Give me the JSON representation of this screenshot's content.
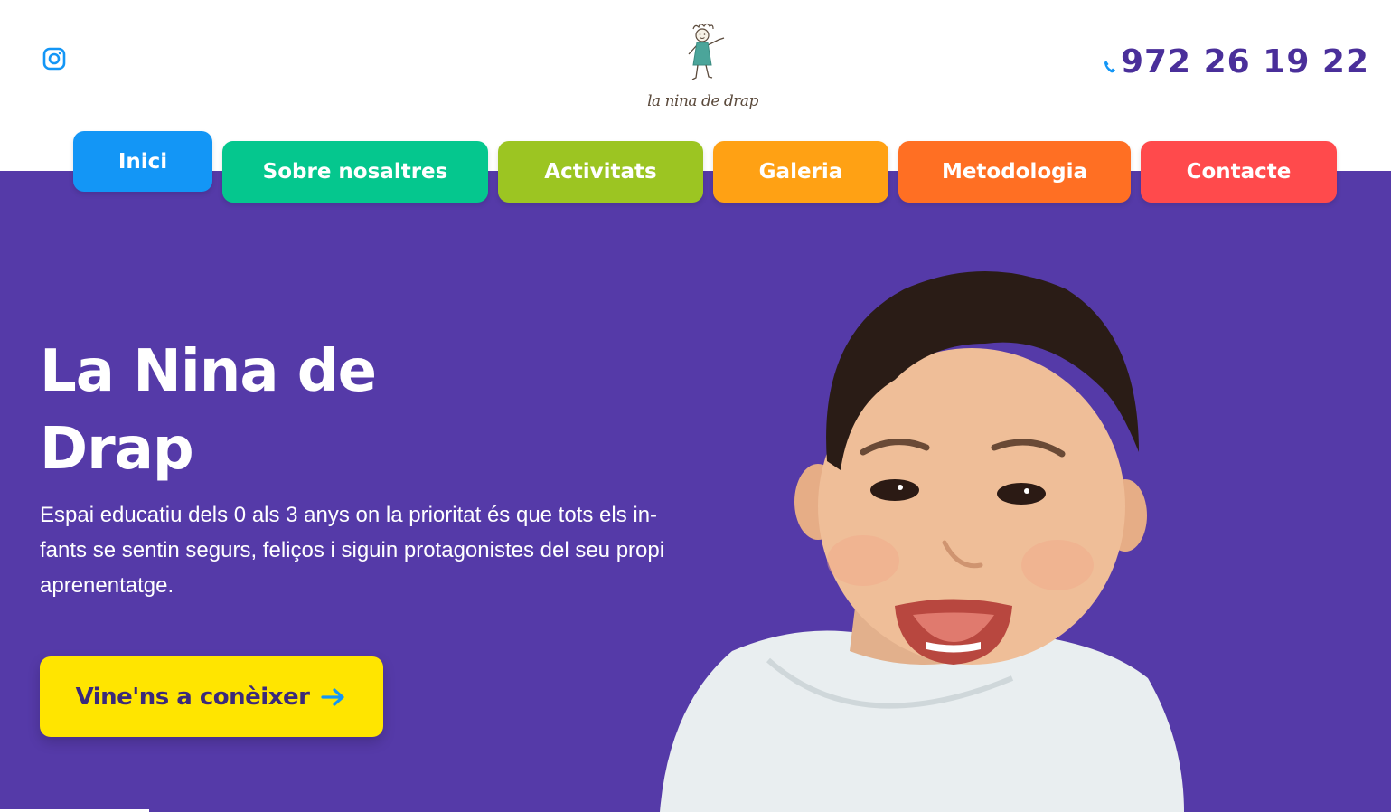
{
  "header": {
    "instagram_icon": "instagram-icon",
    "logo_text": "la nina de drap",
    "phone": "972 26 19 22",
    "phone_icon": "phone-icon"
  },
  "nav": {
    "items": [
      {
        "label": "Inici",
        "color": "#1396f6",
        "active": true
      },
      {
        "label": "Sobre nosaltres",
        "color": "#05c78e"
      },
      {
        "label": "Activitats",
        "color": "#9cc522"
      },
      {
        "label": "Galeria",
        "color": "#ffa114"
      },
      {
        "label": "Metodologia",
        "color": "#ff6f23"
      },
      {
        "label": "Contacte",
        "color": "#ff4a4c"
      }
    ]
  },
  "hero": {
    "background": "#553aa8",
    "title": "La Nina de Drap",
    "description": "Espai educatiu dels 0 als 3 anys on la prioritat és que tots els in-fants se sentin segurs, feliços i siguin protagonistes del seu propi aprenentatge.",
    "cta_label": "Vine'ns a conèixer",
    "cta_color": "#ffe500",
    "cta_icon": "arrow-right-icon",
    "image": "smiling-baby-photo"
  }
}
